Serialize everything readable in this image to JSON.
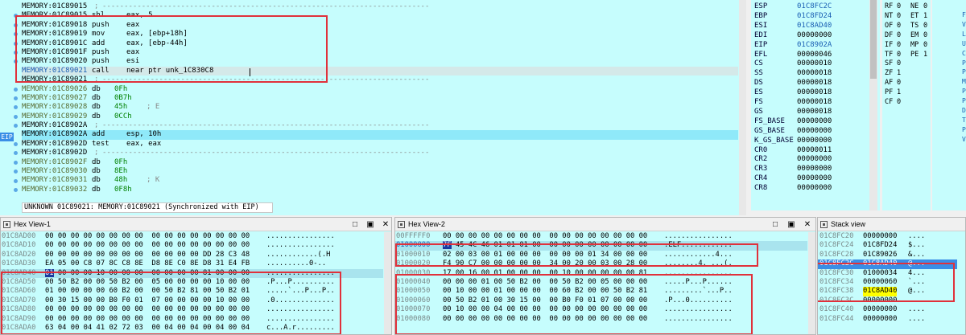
{
  "disasm": {
    "lines": [
      {
        "addr": "MEMORY:01C89015",
        "mn": ";",
        "op": "---------------------------------------------------------------------------",
        "kind": "sep"
      },
      {
        "addr": "MEMORY:01C89015",
        "mn": "shl",
        "op": "eax, 5",
        "kind": "code"
      },
      {
        "addr": "MEMORY:01C89018",
        "mn": "push",
        "op": "eax",
        "kind": "code"
      },
      {
        "addr": "MEMORY:01C89019",
        "mn": "mov",
        "op": "eax, [ebp+18h]",
        "kind": "code"
      },
      {
        "addr": "MEMORY:01C8901C",
        "mn": "add",
        "op": "eax, [ebp-44h]",
        "kind": "code"
      },
      {
        "addr": "MEMORY:01C8901F",
        "mn": "push",
        "op": "eax",
        "kind": "code"
      },
      {
        "addr": "MEMORY:01C89020",
        "mn": "push",
        "op": "esi",
        "kind": "code"
      },
      {
        "addr": "MEMORY:01C89021",
        "mn": "call",
        "op": "near ptr unk_1C830C8",
        "kind": "code",
        "hl": "gray"
      },
      {
        "addr": "MEMORY:01C89021",
        "mn": ";",
        "op": "---------------------------------------------------------------------------",
        "kind": "sep"
      },
      {
        "addr": "MEMORY:01C89026",
        "mn": "db",
        "op": "0Fh",
        "kind": "data"
      },
      {
        "addr": "MEMORY:01C89027",
        "mn": "db",
        "op": "0B7h",
        "kind": "data"
      },
      {
        "addr": "MEMORY:01C89028",
        "mn": "db",
        "op": "45h",
        "cm": "; E",
        "kind": "data"
      },
      {
        "addr": "MEMORY:01C89029",
        "mn": "db",
        "op": "0CCh",
        "kind": "data"
      },
      {
        "addr": "MEMORY:01C8902A",
        "mn": ";",
        "op": "---------------------------------------------------------------------------",
        "kind": "sep"
      },
      {
        "addr": "MEMORY:01C8902A",
        "mn": "add",
        "op": "esp, 10h",
        "kind": "code",
        "hl": "cyan"
      },
      {
        "addr": "MEMORY:01C8902D",
        "mn": "test",
        "op": "eax, eax",
        "kind": "code"
      },
      {
        "addr": "MEMORY:01C8902D",
        "mn": ";",
        "op": "---------------------------------------------------------------------------",
        "kind": "sep"
      },
      {
        "addr": "MEMORY:01C8902F",
        "mn": "db",
        "op": "0Fh",
        "kind": "data"
      },
      {
        "addr": "MEMORY:01C89030",
        "mn": "db",
        "op": "8Eh",
        "kind": "data"
      },
      {
        "addr": "MEMORY:01C89031",
        "mn": "db",
        "op": "48h",
        "cm": "; K",
        "kind": "data"
      },
      {
        "addr": "MEMORY:01C89032",
        "mn": "db",
        "op": "0F8h",
        "kind": "data"
      }
    ],
    "status": "UNKNOWN 01C89021: MEMORY:01C89021 (Synchronized with EIP)",
    "eip_tag": "EIP"
  },
  "registers": [
    {
      "name": "ESP",
      "value": "01C8FC2C",
      "ptr": true
    },
    {
      "name": "EBP",
      "value": "01C8FD24",
      "ptr": true
    },
    {
      "name": "ESI",
      "value": "01C8AD40",
      "ptr": true
    },
    {
      "name": "EDI",
      "value": "00000000",
      "ptr": false
    },
    {
      "name": "EIP",
      "value": "01C8902A",
      "ptr": true
    },
    {
      "name": "EFL",
      "value": "00000046",
      "ptr": false
    },
    {
      "name": "CS",
      "value": "00000010",
      "ptr": false
    },
    {
      "name": "SS",
      "value": "00000018",
      "ptr": false
    },
    {
      "name": "DS",
      "value": "00000018",
      "ptr": false
    },
    {
      "name": "ES",
      "value": "00000018",
      "ptr": false
    },
    {
      "name": "FS",
      "value": "00000018",
      "ptr": false
    },
    {
      "name": "GS",
      "value": "00000018",
      "ptr": false
    },
    {
      "name": "FS_BASE",
      "value": "00000000",
      "ptr": false
    },
    {
      "name": "GS_BASE",
      "value": "00000000",
      "ptr": false
    },
    {
      "name": "K_GS_BASE",
      "value": "00000000",
      "ptr": false
    },
    {
      "name": "CR0",
      "value": "00000011",
      "ptr": false
    },
    {
      "name": "CR2",
      "value": "00000000",
      "ptr": false
    },
    {
      "name": "CR3",
      "value": "00000000",
      "ptr": false
    },
    {
      "name": "CR4",
      "value": "00000000",
      "ptr": false
    },
    {
      "name": "CR8",
      "value": "00000000",
      "ptr": false
    }
  ],
  "flags_col1": [
    {
      "name": "RF",
      "value": "0"
    },
    {
      "name": "NT",
      "value": "0"
    },
    {
      "name": "OF",
      "value": "0"
    },
    {
      "name": "DF",
      "value": "0"
    },
    {
      "name": "IF",
      "value": "0"
    },
    {
      "name": "TF",
      "value": "0"
    },
    {
      "name": "SF",
      "value": "0"
    },
    {
      "name": "ZF",
      "value": "1"
    },
    {
      "name": "AF",
      "value": "0"
    },
    {
      "name": "PF",
      "value": "1"
    },
    {
      "name": "CF",
      "value": "0"
    }
  ],
  "flags_col2": [
    {
      "name": "NE",
      "value": "0"
    },
    {
      "name": "ET",
      "value": "1"
    },
    {
      "name": "TS",
      "value": "0"
    },
    {
      "name": "EM",
      "value": "0"
    },
    {
      "name": "MP",
      "value": "0"
    },
    {
      "name": "PE",
      "value": "1"
    }
  ],
  "right_strip_letters": [
    "F",
    "V",
    "L",
    "U",
    "C",
    "P",
    "P",
    "M",
    "P",
    "P",
    "D",
    "T",
    "P",
    "V"
  ],
  "hex1": {
    "title": "Hex View-1",
    "rows": [
      {
        "a": "01C8AD00",
        "b": "00 00 00 00 00 00 00 00  00 00 00 00 00 00 00 00",
        "s": "................"
      },
      {
        "a": "01C8AD10",
        "b": "00 00 00 00 00 00 00 00  00 00 00 00 00 00 00 00",
        "s": "................"
      },
      {
        "a": "01C8AD20",
        "b": "00 00 00 00 00 00 00 00  00 00 00 00 DD 28 C3 48",
        "s": "............(.H"
      },
      {
        "a": "01C8AD30",
        "b": "EA 05 00 C8 07 8C C8 8E  D8 8E C0 8E D8 31 E4 FB",
        "s": "..........0-.."
      },
      {
        "a": "01C8AD40",
        "b": "01 00 00 00 10 00 00 00  00 00 00 00 81 00 00 00",
        "s": "................",
        "hl": true,
        "sel": true
      },
      {
        "a": "01C8AD50",
        "b": "00 50 B2 00 00 50 B2 00  05 00 00 00 00 10 00 00",
        "s": ".P...P.........."
      },
      {
        "a": "01C8AD60",
        "b": "01 00 00 00 00 60 B2 00  00 50 B2 81 00 50 B2 01",
        "s": ".....`...P...P.."
      },
      {
        "a": "01C8AD70",
        "b": "00 30 15 00 00 B0 F0 01  07 00 00 00 00 10 00 00",
        "s": ".0.............."
      },
      {
        "a": "01C8AD80",
        "b": "00 00 00 00 00 00 00 00  00 00 00 00 00 00 00 00",
        "s": "................"
      },
      {
        "a": "01C8AD90",
        "b": "00 00 00 00 00 00 00 00  00 00 00 00 00 00 00 00",
        "s": "................"
      },
      {
        "a": "01C8ADA0",
        "b": "63 04 00 04 41 02 72 03  00 04 00 04 00 04 00 04",
        "s": "c...A.r........."
      }
    ]
  },
  "hex2": {
    "title": "Hex View-2",
    "rows": [
      {
        "a": "00FFFFF0",
        "b": "00 00 00 00 00 00 00 00  00 00 00 00 00 00 00 00",
        "s": "................"
      },
      {
        "a": "01000000",
        "b": "7F 45 4C 46 01 01 01 00  00 00 00 00 00 00 00 00",
        "s": ".ELF............",
        "hl": true,
        "sel": true,
        "blue": true
      },
      {
        "a": "01000010",
        "b": "02 00 03 00 01 00 00 00  00 00 00 01 34 00 00 00",
        "s": "............4..."
      },
      {
        "a": "01000020",
        "b": "F4 90 C7 00 00 00 00 00  34 00 20 00 03 00 28 00",
        "s": "........4. ...(."
      },
      {
        "a": "01000030",
        "b": "17 00 16 00 01 00 00 00  00 10 00 00 00 00 00 81",
        "s": "................"
      },
      {
        "a": "01000040",
        "b": "00 00 00 01 00 50 B2 00  00 50 B2 00 05 00 00 00",
        "s": ".....P...P......"
      },
      {
        "a": "01000050",
        "b": "00 10 00 00 01 00 00 00  00 60 B2 00 00 50 B2 81",
        "s": ".........`...P.."
      },
      {
        "a": "01000060",
        "b": "00 50 B2 01 00 30 15 00  00 B0 F0 01 07 00 00 00",
        "s": ".P...0.........."
      },
      {
        "a": "01000070",
        "b": "00 10 00 00 04 00 00 00  00 00 00 00 00 00 00 00",
        "s": "................"
      },
      {
        "a": "01000080",
        "b": "00 00 00 00 00 00 00 00  00 00 00 00 00 00 00 00",
        "s": "................"
      }
    ]
  },
  "stack": {
    "title": "Stack view",
    "rows": [
      {
        "a": "01C8FC20",
        "v": "00000000",
        "c": "...."
      },
      {
        "a": "01C8FC24",
        "v": "01C8FD24",
        "c": "$..."
      },
      {
        "a": "01C8FC28",
        "v": "01C89026",
        "c": "&..."
      },
      {
        "a": "01C8FC2C",
        "v": "01C8AD40",
        "c": "@...",
        "hl": true
      },
      {
        "a": "01C8FC30",
        "v": "01000034",
        "c": "4..."
      },
      {
        "a": "01C8FC34",
        "v": "00000060",
        "c": "`..."
      },
      {
        "a": "01C8FC38",
        "v": "01C8AD40",
        "c": "@...",
        "yellow": true
      },
      {
        "a": "01C8FC3C",
        "v": "00000000",
        "c": "...."
      },
      {
        "a": "01C8FC40",
        "v": "00000000",
        "c": "...."
      },
      {
        "a": "01C8FC44",
        "v": "00000000",
        "c": "...."
      }
    ]
  },
  "window_buttons": {
    "min": "□",
    "restore": "▣",
    "close": "✕"
  }
}
